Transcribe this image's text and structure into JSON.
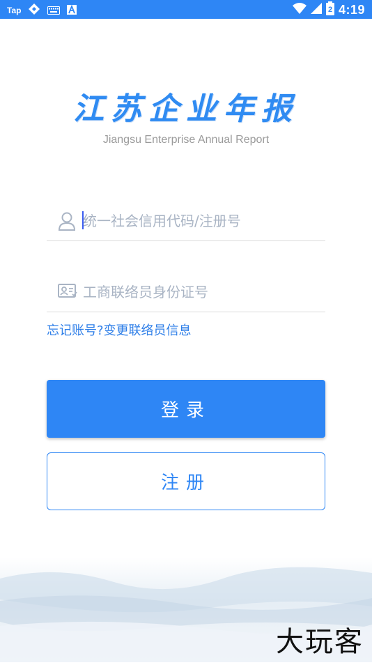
{
  "status_bar": {
    "carrier_label": "Tap",
    "time": "4:19",
    "battery_level": "2",
    "icons": [
      "nav-icon",
      "keyboard-icon",
      "font-a-icon",
      "wifi-icon",
      "signal-icon",
      "battery-icon"
    ]
  },
  "logo": {
    "title": "江苏企业年报",
    "subtitle": "Jiangsu Enterprise Annual Report"
  },
  "form": {
    "credit_code": {
      "placeholder": "统一社会信用代码/注册号",
      "value": ""
    },
    "contact_id": {
      "placeholder": "工商联络员身份证号",
      "value": ""
    }
  },
  "links": {
    "forgot": "忘记账号?",
    "change_contact": "变更联络员信息"
  },
  "buttons": {
    "login": "登录",
    "register": "注册"
  },
  "watermark": "大玩客",
  "colors": {
    "primary": "#2e86f5",
    "link": "#2f7fe8",
    "placeholder": "#a9b4c4"
  }
}
